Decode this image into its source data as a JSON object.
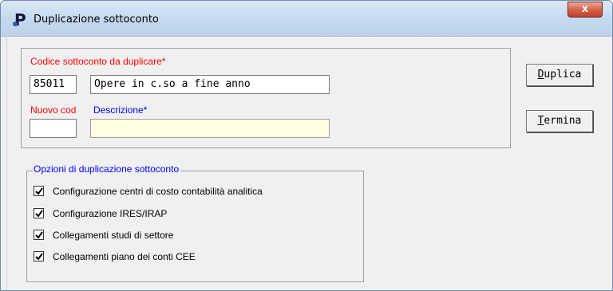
{
  "window": {
    "title": "Duplicazione sottoconto",
    "close_label": "x",
    "icon": "app-p-icon"
  },
  "form": {
    "codice_label": "Codice sottoconto da duplicare*",
    "codice_value": "85011",
    "descrizione_source_value": "Opere in c.so a fine anno",
    "nuovo_cod_label": "Nuovo cod",
    "descrizione_label": "Descrizione*",
    "nuovo_cod_value": "",
    "descrizione_value": ""
  },
  "buttons": {
    "duplica_mnemonic": "D",
    "duplica_rest": "uplica",
    "termina_mnemonic": "T",
    "termina_rest": "ermina"
  },
  "options": {
    "title": "Opzioni di duplicazione sottoconto",
    "items": [
      {
        "label": "Configurazione centri di costo contabilità analitica",
        "checked": true
      },
      {
        "label": "Configurazione IRES/IRAP",
        "checked": true
      },
      {
        "label": "Collegamenti studi di settore",
        "checked": true
      },
      {
        "label": "Collegamenti piano dei conti CEE",
        "checked": true
      }
    ]
  },
  "colors": {
    "required_label": "#ff0000",
    "blue_label": "#0000ff",
    "readonly_field": "#ffffe1"
  }
}
